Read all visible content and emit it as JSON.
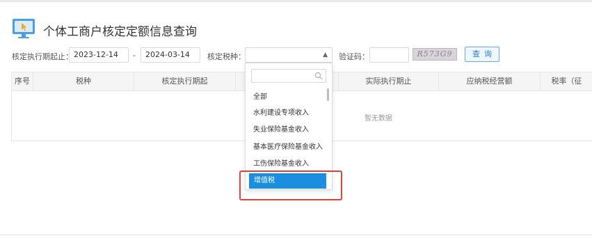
{
  "page": {
    "title": "个体工商户核定定额信息查询",
    "icon": "monitor-cursor-icon"
  },
  "filters": {
    "period_label": "核定执行期起止：",
    "start_date": "2023-12-14",
    "date_separator": "-",
    "end_date": "2024-03-14",
    "tax_type_label": "核定税种：",
    "tax_type_value": "",
    "captcha_label": "验证码：",
    "captcha_value": "",
    "captcha_image_text": "R573G9",
    "query_button": "查询"
  },
  "table": {
    "columns": [
      "序号",
      "税种",
      "核定执行期起",
      "",
      "实际执行期止",
      "应纳税经营额",
      "税率（征"
    ],
    "empty_text": "暂无数据"
  },
  "dropdown": {
    "search_placeholder": "",
    "options": [
      "全部",
      "水利建设专项收入",
      "失业保险基金收入",
      "基本医疗保险基金收入",
      "工伤保险基金收入",
      "增值税"
    ],
    "selected": "增值税"
  },
  "colors": {
    "accent": "#1a8fe0",
    "highlight": "#e0403a",
    "query_button_text": "#2a7ed3"
  }
}
